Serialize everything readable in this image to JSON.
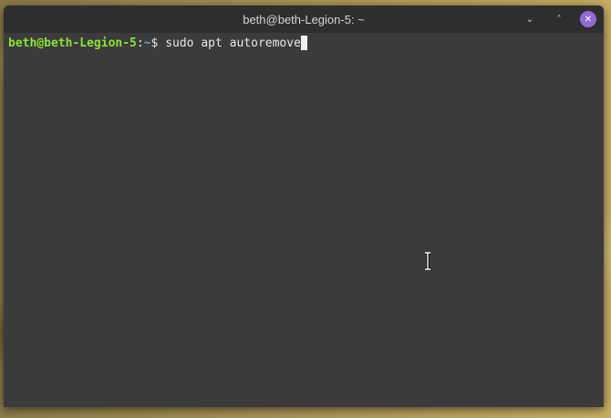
{
  "window": {
    "title": "beth@beth-Legion-5: ~",
    "controls": {
      "minimize_icon": "⌄",
      "maximize_icon": "˄",
      "close_icon": "✕"
    }
  },
  "terminal": {
    "prompt_user_host": "beth@beth-Legion-5",
    "prompt_sep": ":",
    "prompt_path": "~",
    "prompt_symbol": "$",
    "command": " sudo apt autoremove"
  },
  "colors": {
    "prompt_user": "#8ae234",
    "prompt_path": "#729fcf",
    "close_button": "#8e6ad3",
    "terminal_bg": "#3b3b3b",
    "titlebar_bg": "#2e2e2e"
  }
}
